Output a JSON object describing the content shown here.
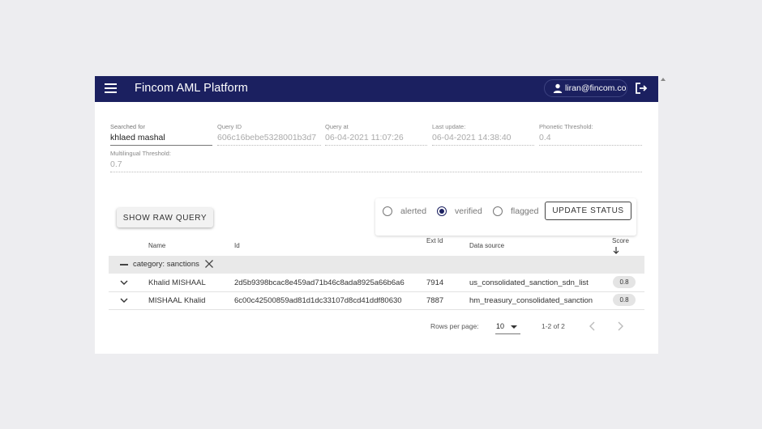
{
  "header": {
    "title": "Fincom AML Platform",
    "user_email": "liran@fincom.co"
  },
  "query": {
    "searched_for": {
      "label": "Searched for",
      "value": "khlaed mashal"
    },
    "query_id": {
      "label": "Query ID",
      "value": "606c16bebe5328001b3d7"
    },
    "query_at": {
      "label": "Query at",
      "value": "06-04-2021 11:07:26"
    },
    "last_update": {
      "label": "Last update:",
      "value": "06-04-2021 14:38:40"
    },
    "phonetic_threshold": {
      "label": "Phonetic Threshold:",
      "value": "0.4"
    },
    "multilingual_threshold": {
      "label": "Multilingual Threshold:",
      "value": "0.7"
    }
  },
  "actions": {
    "show_raw_query": "SHOW RAW QUERY",
    "update_status": "UPDATE STATUS"
  },
  "status_options": [
    {
      "label": "alerted",
      "checked": false
    },
    {
      "label": "verified",
      "checked": true
    },
    {
      "label": "flagged",
      "checked": false
    }
  ],
  "table": {
    "columns": {
      "name": "Name",
      "id": "Id",
      "ext_id": "Ext Id",
      "data_source": "Data source",
      "score": "Score"
    },
    "group": "category: sanctions",
    "rows": [
      {
        "name": "Khalid MISHAAL",
        "id": "2d5b9398bcac8e459ad71b46c8ada8925a66b6a6",
        "ext_id": "7914",
        "data_source": "us_consolidated_sanction_sdn_list",
        "score": "0.8"
      },
      {
        "name": "MISHAAL Khalid",
        "id": "6c00c42500859ad81d1dc33107d8cd41ddf80630",
        "ext_id": "7887",
        "data_source": "hm_treasury_consolidated_sanction",
        "score": "0.8"
      }
    ]
  },
  "pagination": {
    "rows_per_page_label": "Rows per page:",
    "rows_per_page": "10",
    "range": "1-2 of 2"
  },
  "colors": {
    "header_bg": "#1b2060",
    "accent": "#1b2060"
  }
}
